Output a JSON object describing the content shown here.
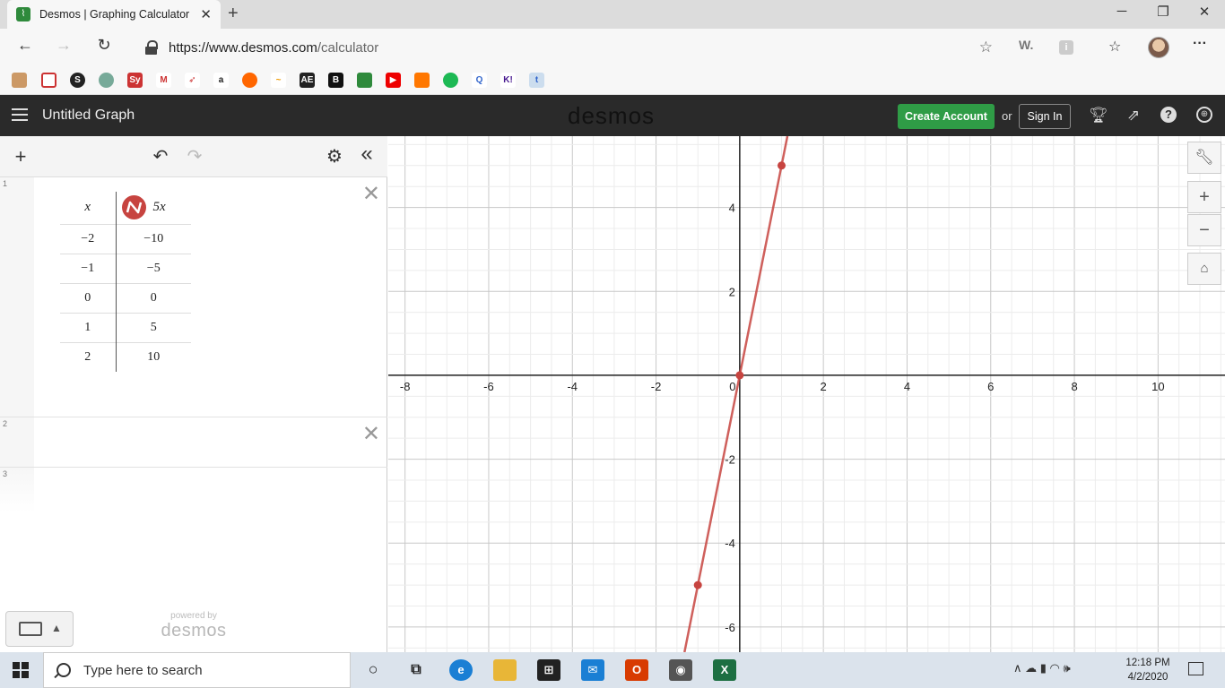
{
  "browser": {
    "tab_title": "Desmos | Graphing Calculator",
    "url_prefix": "https://www.desmos.com",
    "url_path": "/calculator",
    "new_tab_symbol": "+",
    "close_tab_symbol": "✕"
  },
  "header": {
    "graph_title": "Untitled Graph",
    "wordmark": "desmos",
    "create_account": "Create Account",
    "or": "or",
    "sign_in": "Sign In"
  },
  "expressions": {
    "rows": [
      {
        "index": "1"
      },
      {
        "index": "2"
      },
      {
        "index": "3"
      }
    ],
    "table": {
      "col1_header": "x",
      "col2_header": "5x",
      "x": [
        "−2",
        "−1",
        "0",
        "1",
        "2"
      ],
      "y": [
        "−10",
        "−5",
        "0",
        "5",
        "10"
      ]
    },
    "powered_by": "powered by",
    "powered_brand": "desmos"
  },
  "graph": {
    "x_range": [
      -8.4,
      11.6
    ],
    "y_range": [
      -6.6,
      5.7
    ],
    "x_ticks": [
      -8,
      -6,
      -4,
      -2,
      0,
      2,
      4,
      6,
      8,
      10
    ],
    "y_ticks": [
      -6,
      -4,
      -2,
      2,
      4
    ],
    "line_color": "#c74440",
    "function": "y = 5x",
    "points": [
      [
        -1,
        -5
      ],
      [
        0,
        0
      ],
      [
        1,
        5
      ]
    ]
  },
  "taskbar": {
    "search_placeholder": "Type here to search",
    "time": "12:18 PM",
    "date": "4/2/2020"
  },
  "colors": {
    "header_bg": "#2a2a2a",
    "create_account_bg": "#2f9c46",
    "series_red": "#c74440"
  }
}
